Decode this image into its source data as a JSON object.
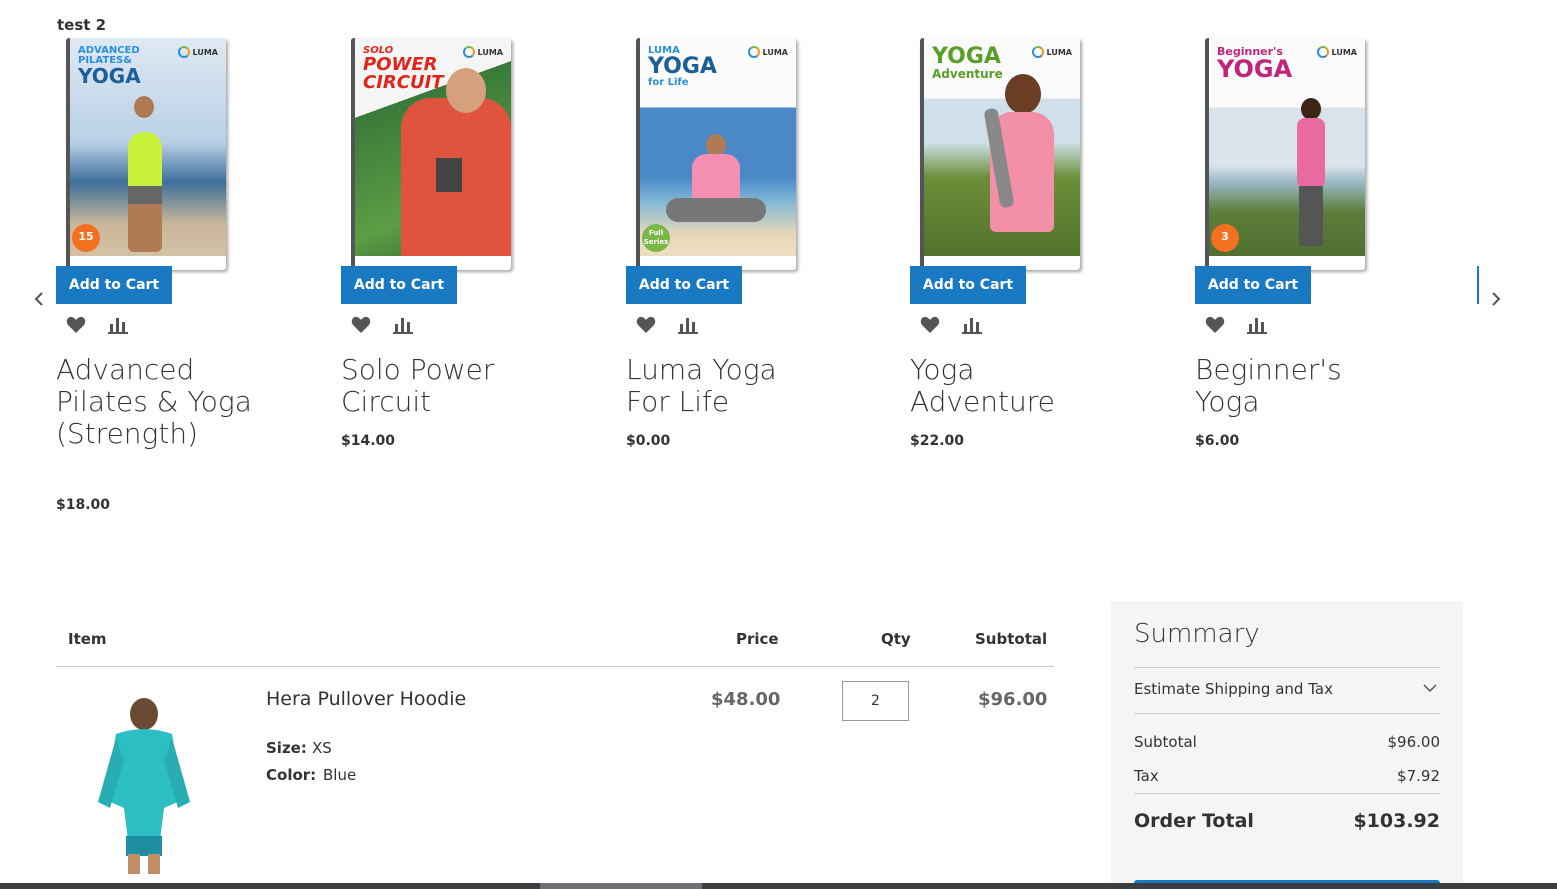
{
  "section": {
    "title": "test 2"
  },
  "carousel": {
    "products": [
      {
        "name": "Advanced Pilates & Yoga (Strength)",
        "price": "$18.00",
        "add_label": "Add to Cart",
        "cover": {
          "title_line1": "ADVANCED",
          "title_line2": "PILATES&",
          "title_line3": "YOGA",
          "badge": "15"
        }
      },
      {
        "name": "Solo Power Circuit",
        "price": "$14.00",
        "add_label": "Add to Cart",
        "cover": {
          "title_line1": "SOLO",
          "title_line2": "POWER",
          "title_line3": "CIRCUIT"
        }
      },
      {
        "name": "Luma Yoga For Life",
        "price": "$0.00",
        "add_label": "Add to Cart",
        "cover": {
          "title_line1": "LUMA",
          "title_line2": "YOGA",
          "title_line3": "for Life",
          "badge": "Full Series"
        }
      },
      {
        "name": "Yoga Adventure",
        "price": "$22.00",
        "add_label": "Add to Cart",
        "cover": {
          "title_line1": "YOGA",
          "title_line2": "Adventure"
        }
      },
      {
        "name": "Beginner's Yoga",
        "price": "$6.00",
        "add_label": "Add to Cart",
        "cover": {
          "title_line1": "Beginner's",
          "title_line2": "YOGA",
          "badge": "3"
        }
      }
    ],
    "logo_text": "LUMA"
  },
  "cart": {
    "headers": {
      "item": "Item",
      "price": "Price",
      "qty": "Qty",
      "subtotal": "Subtotal"
    },
    "item": {
      "name": "Hera Pullover Hoodie",
      "options": [
        {
          "label": "Size:",
          "value": "XS"
        },
        {
          "label": "Color:",
          "value": "Blue"
        }
      ],
      "price": "$48.00",
      "qty": "2",
      "subtotal": "$96.00"
    }
  },
  "summary": {
    "title": "Summary",
    "estimate_label": "Estimate Shipping and Tax",
    "subtotal_label": "Subtotal",
    "subtotal_value": "$96.00",
    "tax_label": "Tax",
    "tax_value": "$7.92",
    "total_label": "Order Total",
    "total_value": "$103.92"
  },
  "colors": {
    "primary": "#1979c3",
    "text": "#333333",
    "summary_bg": "#f5f5f5"
  }
}
